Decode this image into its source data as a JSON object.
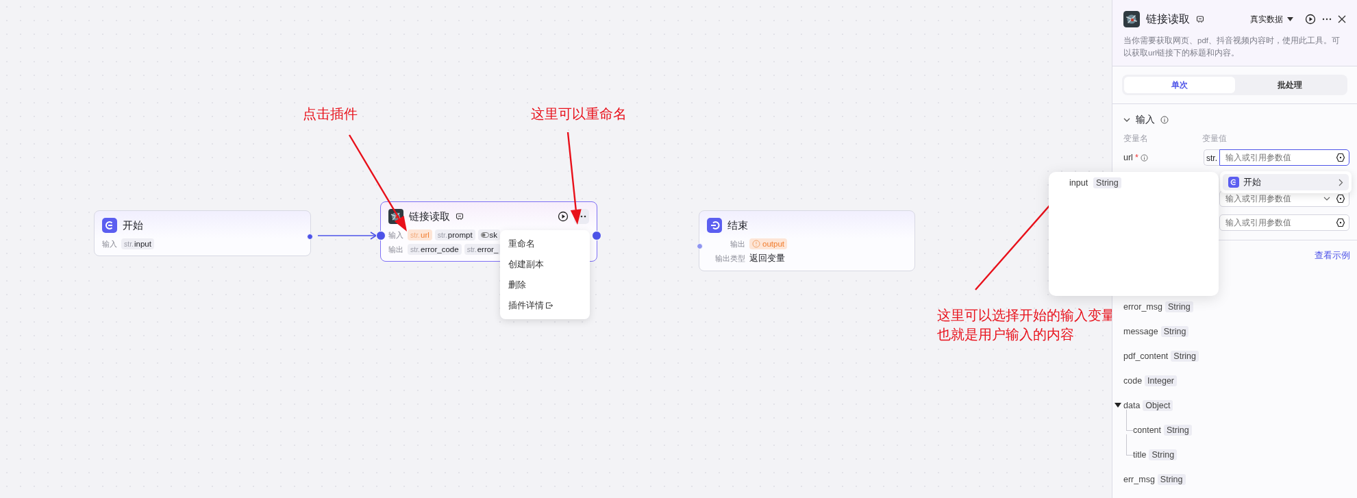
{
  "canvas": {
    "nodes": [
      {
        "kind": "start",
        "title": "开始",
        "selected": false,
        "rows": [
          {
            "label": "输入",
            "tags": [
              {
                "prefix": "str.",
                "name": "input",
                "kind": "normal"
              }
            ]
          }
        ]
      },
      {
        "kind": "plugin",
        "title": "链接读取",
        "selected": true,
        "rows": [
          {
            "label": "输入",
            "tags": [
              {
                "prefix": "str.",
                "name": "url",
                "kind": "highlight"
              },
              {
                "prefix": "str.",
                "name": "prompt",
                "kind": "normal"
              },
              {
                "name": "sk",
                "kind": "toggle"
              }
            ]
          },
          {
            "label": "输出",
            "tags": [
              {
                "prefix": "str.",
                "name": "error_code",
                "kind": "normal"
              },
              {
                "prefix": "str.",
                "name": "error_",
                "kind": "normal"
              }
            ]
          }
        ]
      },
      {
        "kind": "end",
        "title": "结束",
        "selected": false,
        "rows": [
          {
            "label": "输出",
            "tags": [
              {
                "name": "output",
                "kind": "warning"
              }
            ]
          },
          {
            "label": "输出类型",
            "value": "返回变量"
          }
        ]
      }
    ],
    "menu": {
      "items": [
        {
          "label": "重命名",
          "external": false
        },
        {
          "label": "创建副本",
          "external": false
        },
        {
          "label": "删除",
          "external": false
        },
        {
          "label": "插件详情",
          "external": true
        }
      ]
    },
    "annotations": [
      {
        "text": "点击插件"
      },
      {
        "text": "这里可以重命名"
      },
      {
        "text": "这里可以选择开始的输入变量"
      },
      {
        "text": "也就是用户输入的内容"
      }
    ]
  },
  "panel": {
    "title": "链接读取",
    "mode": "真实数据",
    "description": "当你需要获取网页、pdf、抖音视频内容时，使用此工具。可以获取url链接下的标题和内容。",
    "tabs": [
      {
        "label": "单次",
        "selected": true
      },
      {
        "label": "批处理",
        "selected": false
      }
    ],
    "input_section": {
      "title": "输入",
      "expanded": true,
      "headers": [
        "变量名",
        "变量值"
      ],
      "params": [
        {
          "name": "url",
          "required_mark": "*",
          "type_prefix": "str.",
          "placeholder": "输入或引用参数值",
          "focused": true
        },
        {
          "placeholder": "输入或引用参数值",
          "focused": false,
          "dropdown": true
        },
        {
          "placeholder": "输入或引用参数值",
          "focused": false
        }
      ]
    },
    "reference_menu": {
      "items": [
        {
          "label": "开始"
        }
      ]
    },
    "variable_popup": {
      "items": [
        {
          "name": "input",
          "type": "String"
        }
      ]
    },
    "example_link": "查看示例",
    "outputs": [
      {
        "name": "error_msg",
        "type": "String"
      },
      {
        "name": "message",
        "type": "String"
      },
      {
        "name": "pdf_content",
        "type": "String"
      },
      {
        "name": "code",
        "type": "Integer"
      },
      {
        "name": "data",
        "type": "Object",
        "expanded": true,
        "children": [
          {
            "name": "content",
            "type": "String"
          },
          {
            "name": "title",
            "type": "String"
          }
        ]
      },
      {
        "name": "err_msg",
        "type": "String"
      }
    ]
  }
}
